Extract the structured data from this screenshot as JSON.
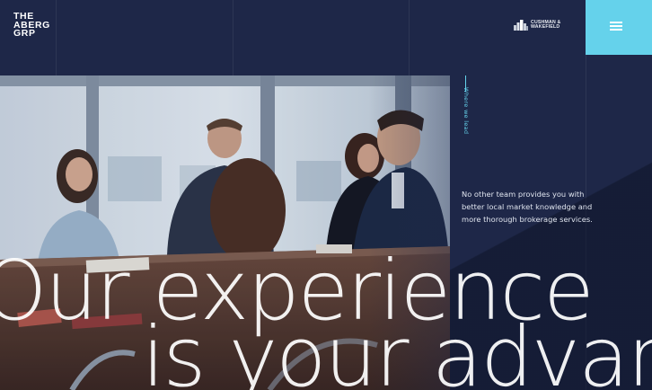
{
  "brand": {
    "logo_lines": [
      "THE",
      "ABERG",
      "GRP"
    ],
    "partner_lines": [
      "CUSHMAN &",
      "WAKEFIELD"
    ],
    "accent_color": "#65d2eb",
    "background_color": "#1e2748"
  },
  "menu": {
    "icon": "hamburger-menu-icon"
  },
  "hero": {
    "vertical_label": "Where we lead",
    "intro_text": "No other team provides you with better local market knowledge and more thorough brokerage services.",
    "headline_line1": "Our experience",
    "headline_line2": "is your advanta"
  }
}
